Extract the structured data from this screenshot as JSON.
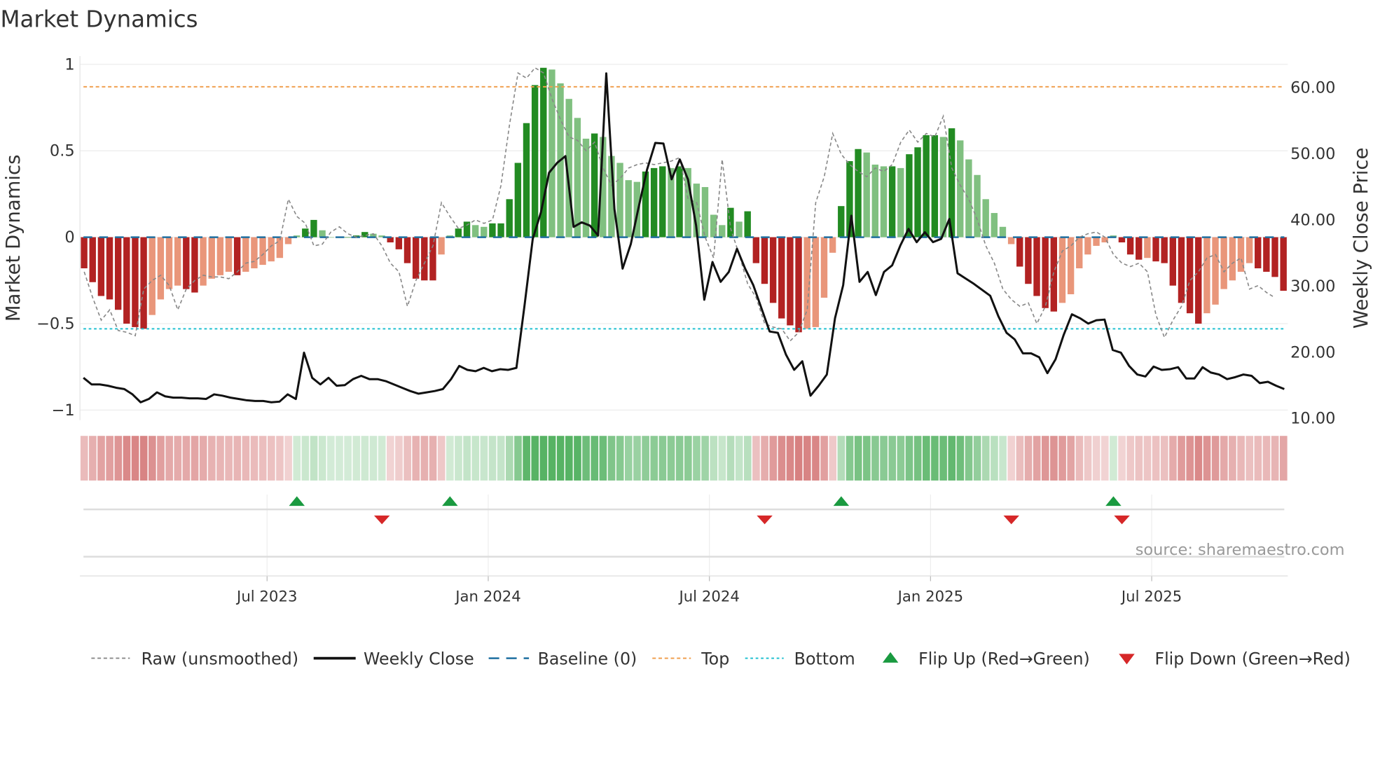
{
  "title": "Market Dynamics",
  "source": "source: sharemaestro.com",
  "colors": {
    "green_dark": "#228B22",
    "green_light": "#80C080",
    "red_dark": "#B22222",
    "red_light": "#E9967A",
    "top": "#F0A050",
    "bottom": "#20C0D0",
    "baseline": "#1F6FA0",
    "close": "#111111",
    "raw": "#888888",
    "flip_up": "#1A9A40",
    "flip_down": "#D62728"
  },
  "chart_data": {
    "type": "bar",
    "title": "Market Dynamics",
    "xlabel": "",
    "ylabel": "Market Dynamics",
    "y2label": "Weekly Close Price",
    "ylim": [
      -1.02,
      1.02
    ],
    "y2lim": [
      8.5,
      62.5
    ],
    "yticks": [
      {
        "v": 1,
        "label": "1"
      },
      {
        "v": 0.5,
        "label": "0.5"
      },
      {
        "v": 0,
        "label": "0"
      },
      {
        "v": -0.5,
        "label": "−0.5"
      },
      {
        "v": -1,
        "label": "−1"
      }
    ],
    "y2ticks": [
      {
        "v": 60,
        "label": "60.00"
      },
      {
        "v": 50,
        "label": "50.00"
      },
      {
        "v": 40,
        "label": "40.00"
      },
      {
        "v": 30,
        "label": "30.00"
      },
      {
        "v": 20,
        "label": "20.00"
      },
      {
        "v": 10,
        "label": "10.00"
      }
    ],
    "xticks": [
      {
        "week": 22,
        "label": "Jul 2023"
      },
      {
        "week": 48,
        "label": "Jan 2024"
      },
      {
        "week": 74,
        "label": "Jul 2024"
      },
      {
        "week": 100,
        "label": "Jan 2025"
      },
      {
        "week": 126,
        "label": "Jul 2025"
      }
    ],
    "top_level": 0.87,
    "bottom_level": -0.53,
    "baseline": 0,
    "dynamics": [
      -0.18,
      -0.26,
      -0.34,
      -0.36,
      -0.42,
      -0.5,
      -0.52,
      -0.53,
      -0.45,
      -0.36,
      -0.3,
      -0.28,
      -0.3,
      -0.32,
      -0.28,
      -0.24,
      -0.22,
      -0.2,
      -0.22,
      -0.2,
      -0.18,
      -0.16,
      -0.14,
      -0.12,
      -0.04,
      0.01,
      0.05,
      0.1,
      0.04,
      0.0,
      0.0,
      0.0,
      0.01,
      0.03,
      0.02,
      0.01,
      -0.03,
      -0.07,
      -0.15,
      -0.24,
      -0.25,
      -0.25,
      -0.1,
      0.01,
      0.05,
      0.09,
      0.07,
      0.06,
      0.08,
      0.08,
      0.22,
      0.43,
      0.66,
      0.88,
      0.98,
      0.97,
      0.89,
      0.8,
      0.69,
      0.57,
      0.6,
      0.58,
      0.47,
      0.43,
      0.33,
      0.32,
      0.38,
      0.4,
      0.41,
      0.4,
      0.41,
      0.4,
      0.31,
      0.29,
      0.13,
      0.07,
      0.17,
      0.09,
      0.15,
      -0.15,
      -0.27,
      -0.38,
      -0.47,
      -0.51,
      -0.55,
      -0.53,
      -0.52,
      -0.35,
      -0.09,
      0.18,
      0.44,
      0.51,
      0.49,
      0.42,
      0.41,
      0.41,
      0.4,
      0.48,
      0.52,
      0.59,
      0.59,
      0.58,
      0.63,
      0.56,
      0.45,
      0.36,
      0.22,
      0.14,
      0.06,
      -0.04,
      -0.17,
      -0.27,
      -0.34,
      -0.41,
      -0.43,
      -0.38,
      -0.33,
      -0.18,
      -0.1,
      -0.05,
      -0.03,
      0.01,
      -0.03,
      -0.1,
      -0.13,
      -0.12,
      -0.14,
      -0.15,
      -0.28,
      -0.38,
      -0.44,
      -0.5,
      -0.44,
      -0.39,
      -0.3,
      -0.25,
      -0.2,
      -0.15,
      -0.18,
      -0.2,
      -0.23,
      -0.31
    ],
    "raw": [
      -0.2,
      -0.35,
      -0.48,
      -0.42,
      -0.54,
      -0.55,
      -0.57,
      -0.3,
      -0.25,
      -0.22,
      -0.28,
      -0.42,
      -0.3,
      -0.25,
      -0.22,
      -0.23,
      -0.23,
      -0.24,
      -0.2,
      -0.15,
      -0.14,
      -0.1,
      -0.05,
      -0.02,
      0.22,
      0.12,
      0.08,
      -0.05,
      -0.04,
      0.03,
      0.06,
      0.02,
      0.0,
      0.01,
      0.02,
      -0.05,
      -0.15,
      -0.2,
      -0.4,
      -0.25,
      -0.15,
      -0.05,
      0.2,
      0.12,
      0.05,
      0.07,
      0.1,
      0.08,
      0.1,
      0.3,
      0.65,
      0.95,
      0.92,
      0.98,
      0.95,
      0.8,
      0.68,
      0.58,
      0.56,
      0.5,
      0.55,
      0.4,
      0.3,
      0.34,
      0.4,
      0.42,
      0.43,
      0.42,
      0.43,
      0.44,
      0.46,
      0.22,
      0.2,
      0.0,
      -0.12,
      0.45,
      0.05,
      -0.1,
      -0.27,
      -0.35,
      -0.5,
      -0.52,
      -0.53,
      -0.6,
      -0.55,
      -0.42,
      0.2,
      0.35,
      0.6,
      0.48,
      0.42,
      0.38,
      0.35,
      0.4,
      0.38,
      0.42,
      0.55,
      0.62,
      0.55,
      0.6,
      0.58,
      0.7,
      0.4,
      0.3,
      0.22,
      0.1,
      -0.05,
      -0.15,
      -0.3,
      -0.36,
      -0.4,
      -0.38,
      -0.5,
      -0.4,
      -0.2,
      -0.08,
      -0.05,
      0.0,
      0.02,
      0.03,
      0.0,
      -0.1,
      -0.15,
      -0.17,
      -0.15,
      -0.2,
      -0.45,
      -0.58,
      -0.48,
      -0.4,
      -0.25,
      -0.2,
      -0.12,
      -0.1,
      -0.2,
      -0.15,
      -0.12,
      -0.3,
      -0.28,
      -0.32,
      -0.35
    ],
    "weekly_close": [
      16,
      15,
      15,
      14.8,
      14.5,
      14.3,
      13.5,
      12.3,
      12.8,
      13.8,
      13.2,
      13,
      13,
      12.9,
      12.9,
      12.8,
      13.5,
      13.3,
      13,
      12.8,
      12.6,
      12.5,
      12.5,
      12.3,
      12.4,
      13.5,
      12.8,
      19.8,
      16,
      15,
      16,
      14.8,
      14.9,
      15.8,
      16.3,
      15.8,
      15.8,
      15.5,
      15,
      14.5,
      14,
      13.6,
      13.8,
      14,
      14.3,
      15.8,
      17.8,
      17.2,
      17,
      17.5,
      17,
      17.3,
      17.2,
      17.5,
      27,
      37,
      41,
      47,
      48.5,
      49.5,
      38.8,
      39.5,
      39,
      37.5,
      62,
      41.5,
      32.5,
      36.2,
      42,
      47.5,
      51.5,
      51.4,
      46,
      49,
      46,
      39,
      27.8,
      33.5,
      30.5,
      32,
      35.5,
      32.5,
      30,
      26.5,
      23,
      22.8,
      19.5,
      17.2,
      18.5,
      13.3,
      14.8,
      16.5,
      25,
      30,
      40.5,
      30.5,
      32,
      28.5,
      32,
      33,
      36,
      38.5,
      36.5,
      38,
      36.5,
      37,
      40,
      31.8,
      31,
      30.2,
      29.3,
      28.4,
      25.3,
      22.8,
      21.8,
      19.7,
      19.7,
      19.1,
      16.7,
      18.8,
      22.5,
      25.6,
      25,
      24.2,
      24.7,
      24.8,
      20.2,
      19.8,
      17.8,
      16.5,
      16.2,
      17.7,
      17.2,
      17.3,
      17.6,
      15.9,
      15.9,
      17.6,
      16.8,
      16.5,
      15.8,
      16.1,
      16.5,
      16.3,
      15.2,
      15.4,
      14.8,
      14.3
    ],
    "flip_up_weeks": [
      25,
      43,
      89,
      121
    ],
    "flip_down_weeks": [
      35,
      80,
      109,
      122
    ],
    "legend": [
      {
        "key": "raw",
        "label": "Raw (unsmoothed)"
      },
      {
        "key": "close",
        "label": "Weekly Close"
      },
      {
        "key": "baseline",
        "label": "Baseline (0)"
      },
      {
        "key": "top",
        "label": "Top"
      },
      {
        "key": "bottom",
        "label": "Bottom"
      },
      {
        "key": "flip_up",
        "label": "Flip Up (Red→Green)"
      },
      {
        "key": "flip_down",
        "label": "Flip Down (Green→Red)"
      }
    ],
    "legend_position": "bottom",
    "grid": true
  }
}
